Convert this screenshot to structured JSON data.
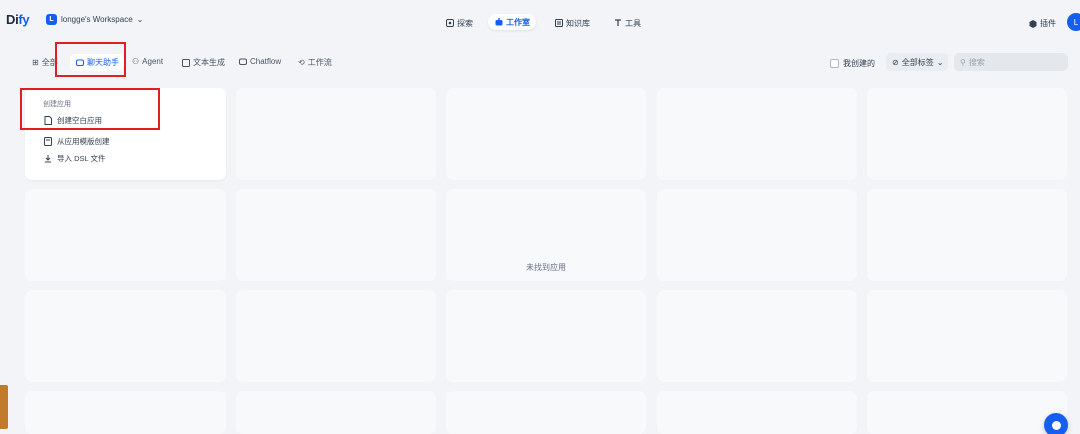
{
  "app": {
    "logo_main": "Di",
    "logo_accent": "fy"
  },
  "workspace": {
    "badge": "L",
    "name": "longge's Workspace"
  },
  "nav": [
    {
      "label": "探索",
      "icon": "explore-icon"
    },
    {
      "label": "工作室",
      "icon": "studio-icon"
    },
    {
      "label": "知识库",
      "icon": "knowledge-icon"
    },
    {
      "label": "工具",
      "icon": "tools-icon"
    }
  ],
  "plugins": {
    "label": "插件"
  },
  "user": {
    "avatar": "L"
  },
  "filter_tabs": [
    {
      "label": "全部",
      "icon": "grid-icon"
    },
    {
      "label": "聊天助手",
      "icon": "chat-icon"
    },
    {
      "label": "Agent",
      "icon": "agent-icon"
    },
    {
      "label": "文本生成",
      "icon": "text-icon"
    },
    {
      "label": "Chatflow",
      "icon": "chatflow-icon"
    },
    {
      "label": "工作流",
      "icon": "workflow-icon"
    }
  ],
  "created_by_me": {
    "label": "我创建的"
  },
  "tag_select": {
    "label": "全部标签"
  },
  "search": {
    "placeholder": "搜索"
  },
  "create_card": {
    "title": "创建应用",
    "items": [
      "创建空白应用",
      "从应用模版创建",
      "导入 DSL 文件"
    ]
  },
  "empty_state": {
    "text": "未找到应用"
  },
  "colors": {
    "accent": "#155eef",
    "highlight": "#e02020"
  }
}
